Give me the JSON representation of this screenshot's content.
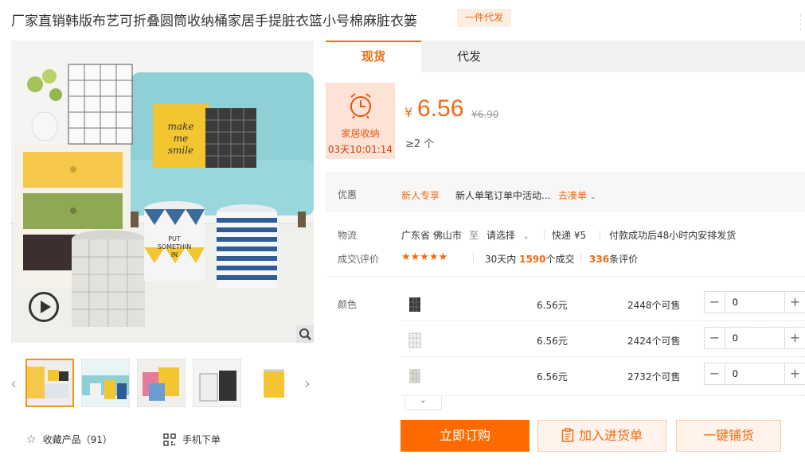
{
  "product": {
    "title": "厂家直销韩版布艺可折叠圆筒收纳桶家居手提脏衣篮小号棉麻脏衣篓",
    "badge": "一件代发"
  },
  "gallery": {
    "main_image_text": [
      "make",
      "me",
      "smile",
      "PUT",
      "SOMETHIN",
      "IN"
    ],
    "thumbnail_count": 5
  },
  "actions": {
    "favorite_label": "收藏产品（91）",
    "mobile_label": "手机下单"
  },
  "tabs": [
    {
      "label": "现货",
      "active": true
    },
    {
      "label": "代发",
      "active": false
    }
  ],
  "promo": {
    "label": "家居收纳",
    "countdown": "03天10:01:14"
  },
  "price": {
    "currency": "¥",
    "current": "6.56",
    "original": "¥6.90",
    "moq": "≥2 个"
  },
  "discount": {
    "label": "优惠",
    "tag": "新人专享",
    "text": "新人单笔订单中活动...",
    "link": "去凑单"
  },
  "logistics": {
    "label": "物流",
    "from": "广东省 佛山市",
    "to_word": "至",
    "destination": "请选择",
    "shipping": "快递 ¥5",
    "dispatch": "付款成功后48小时内安排发货"
  },
  "reviews": {
    "label": "成交\\评价",
    "stars": "★★★★★",
    "sales_prefix": "30天内",
    "sales_count": "1590",
    "sales_suffix": "个成交",
    "review_count": "336",
    "review_suffix": "条评价"
  },
  "variants": {
    "label": "颜色",
    "items": [
      {
        "price": "6.56元",
        "stock": "2448个可售",
        "qty": "0"
      },
      {
        "price": "6.56元",
        "stock": "2424个可售",
        "qty": "0"
      },
      {
        "price": "6.56元",
        "stock": "2732个可售",
        "qty": "0"
      }
    ]
  },
  "buttons": {
    "buy_now": "立即订购",
    "add_to_list": "加入进货单",
    "one_click": "一键铺货"
  },
  "colors": {
    "accent": "#ff6a00",
    "accent_text": "#f26a10",
    "promo_bg": "#fde3d6"
  }
}
